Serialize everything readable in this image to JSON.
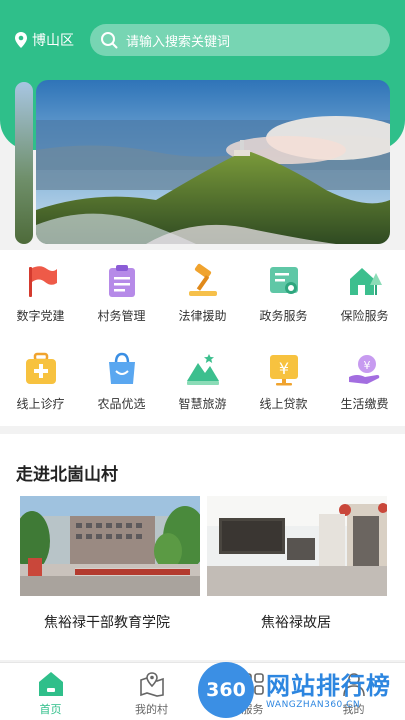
{
  "header": {
    "location": "博山区",
    "search_placeholder": "请输入搜索关键词",
    "accent": "#2fbf8a"
  },
  "services": [
    {
      "label": "数字党建",
      "icon": "red-flag-icon"
    },
    {
      "label": "村务管理",
      "icon": "clipboard-icon"
    },
    {
      "label": "法律援助",
      "icon": "gavel-icon"
    },
    {
      "label": "政务服务",
      "icon": "certificate-icon"
    },
    {
      "label": "保险服务",
      "icon": "house-tree-icon"
    },
    {
      "label": "线上诊疗",
      "icon": "medical-kit-icon"
    },
    {
      "label": "农品优选",
      "icon": "shopping-bag-icon"
    },
    {
      "label": "智慧旅游",
      "icon": "mountain-icon"
    },
    {
      "label": "线上贷款",
      "icon": "yen-board-icon"
    },
    {
      "label": "生活缴费",
      "icon": "hand-coin-icon"
    }
  ],
  "village": {
    "title": "走进北崮山村",
    "items": [
      {
        "caption": "焦裕禄干部教育学院"
      },
      {
        "caption": "焦裕禄故居"
      }
    ]
  },
  "nav": {
    "items": [
      {
        "label": "首页"
      },
      {
        "label": "我的村"
      },
      {
        "label": "服务"
      },
      {
        "label": "我的"
      }
    ]
  },
  "watermark": {
    "badge": "360",
    "title": "网站排行榜",
    "url": "WANGZHAN360.CN"
  }
}
